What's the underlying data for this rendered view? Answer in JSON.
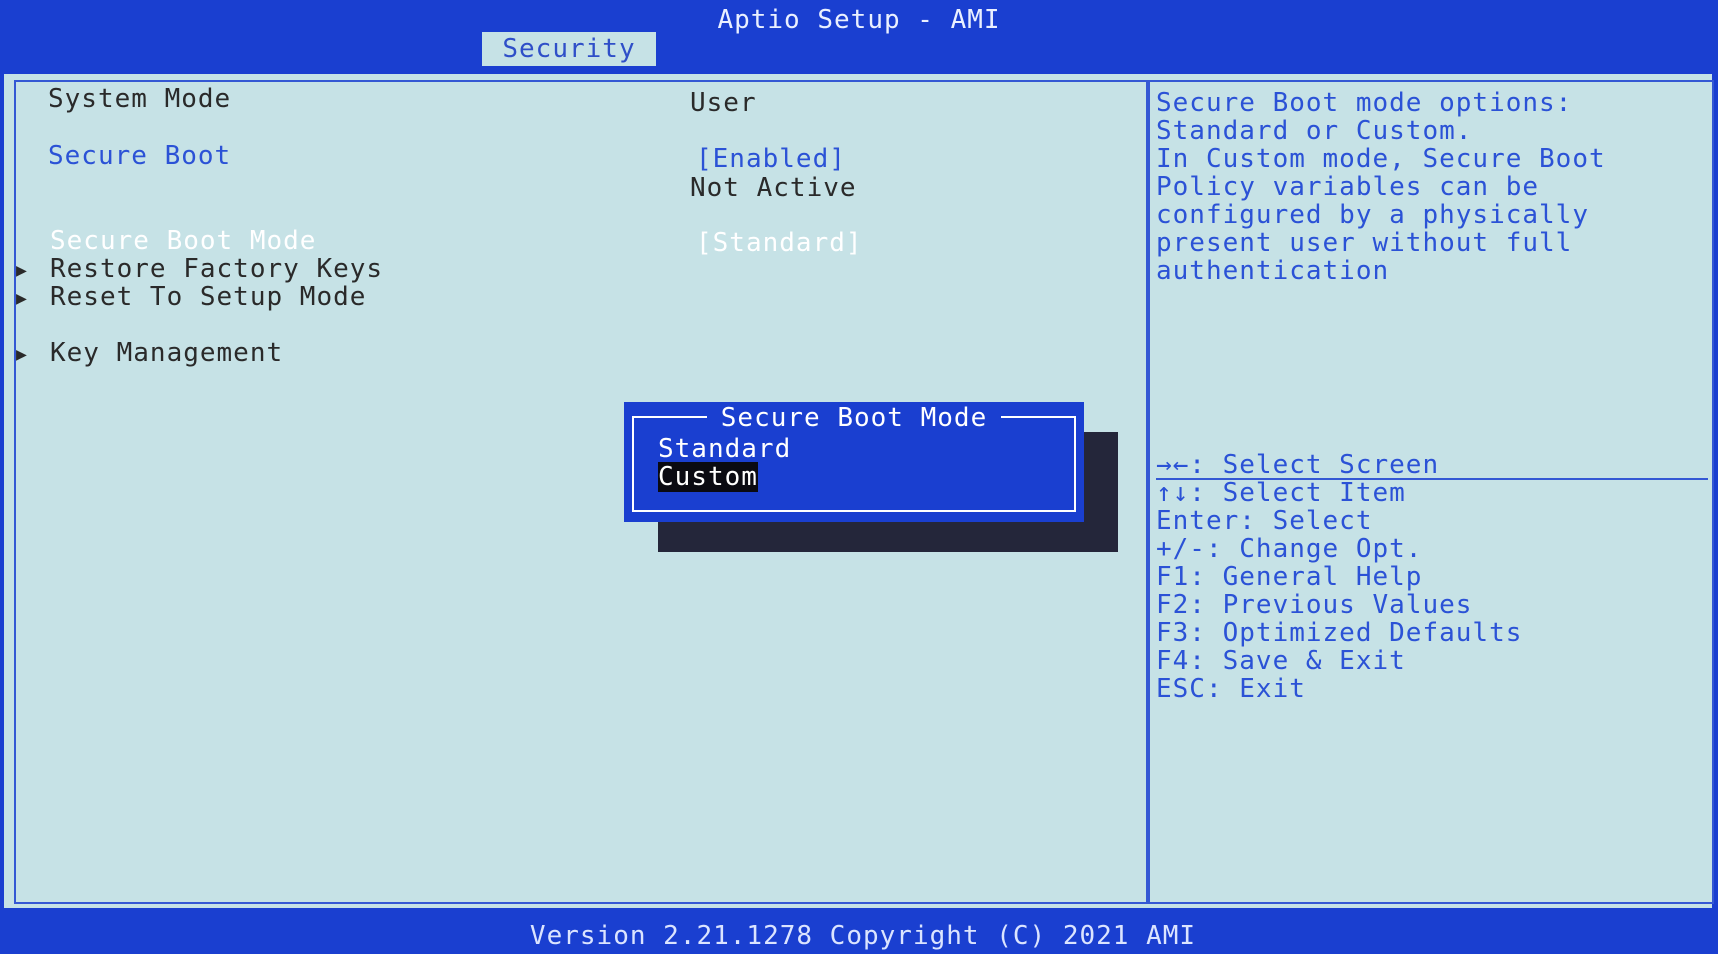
{
  "header": {
    "title": "Aptio Setup - AMI",
    "active_tab": "Security"
  },
  "settings": {
    "system_mode": {
      "label": "System Mode",
      "value": "User"
    },
    "secure_boot": {
      "label": "Secure Boot",
      "value": "[Enabled]",
      "status": "Not Active"
    },
    "secure_boot_mode": {
      "label": "Secure Boot Mode",
      "value": "[Standard]"
    },
    "restore_factory_keys": {
      "label": "Restore Factory Keys"
    },
    "reset_to_setup_mode": {
      "label": "Reset To Setup Mode"
    },
    "key_management": {
      "label": "Key Management"
    }
  },
  "help": {
    "lines": [
      "Secure Boot mode options:",
      "Standard or Custom.",
      "In Custom mode, Secure Boot",
      "Policy variables can be",
      "configured by a physically",
      "present user without full",
      "authentication"
    ]
  },
  "keys": [
    "→←: Select Screen",
    "↑↓: Select Item",
    "Enter: Select",
    "+/-: Change Opt.",
    "F1: General Help",
    "F2: Previous Values",
    "F3: Optimized Defaults",
    "F4: Save & Exit",
    "ESC: Exit"
  ],
  "popup": {
    "title": "Secure Boot Mode",
    "options": [
      "Standard",
      "Custom"
    ],
    "selected": "Custom"
  },
  "footer": {
    "text": "Version 2.21.1278 Copyright (C) 2021 AMI"
  },
  "colors": {
    "background": "#c6e2e6",
    "bar_blue": "#1a3fd0",
    "text_blue": "#2b52d6",
    "text_dark": "#2a2a2a"
  }
}
